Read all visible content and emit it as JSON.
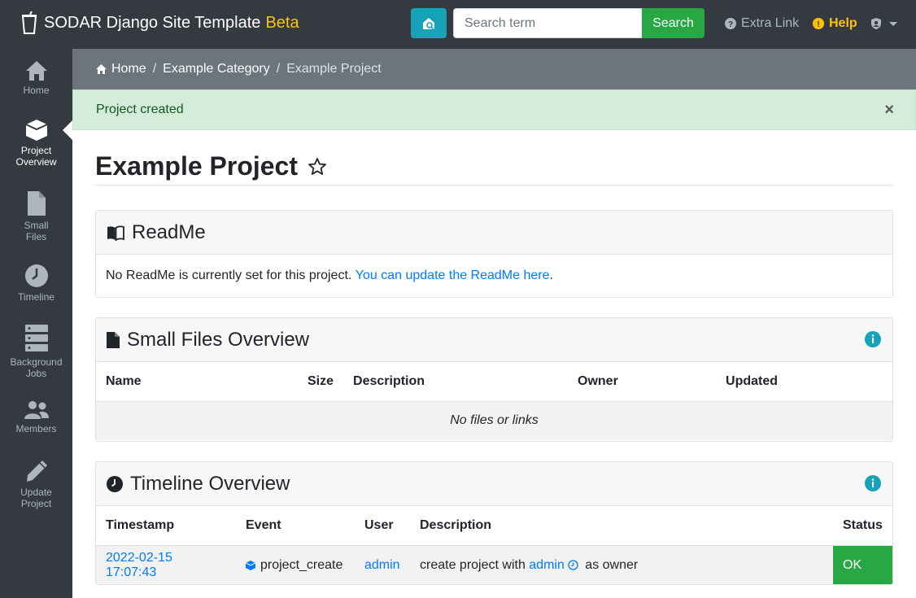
{
  "navbar": {
    "brand": "SODAR Django Site Template",
    "beta": "Beta",
    "search_placeholder": "Search term",
    "search_button": "Search",
    "extra_link": "Extra Link",
    "help": "Help"
  },
  "sidebar": {
    "items": [
      {
        "label": "Home",
        "icon": "home-icon"
      },
      {
        "label": "Project\nOverview",
        "icon": "cube-icon",
        "active": true
      },
      {
        "label": "Small\nFiles",
        "icon": "file-icon"
      },
      {
        "label": "Timeline",
        "icon": "clock-icon"
      },
      {
        "label": "Background\nJobs",
        "icon": "server-icon"
      },
      {
        "label": "Members",
        "icon": "users-icon"
      },
      {
        "label": "Update\nProject",
        "icon": "pencil-icon"
      }
    ]
  },
  "breadcrumb": {
    "home": "Home",
    "category": "Example Category",
    "current": "Example Project"
  },
  "alert": {
    "message": "Project created",
    "close": "×"
  },
  "page": {
    "title": "Example Project"
  },
  "readme": {
    "title": "ReadMe",
    "text": "No ReadMe is currently set for this project. ",
    "link": "You can update the ReadMe here",
    "suffix": "."
  },
  "small_files": {
    "title": "Small Files Overview",
    "columns": [
      "Name",
      "Size",
      "Description",
      "Owner",
      "Updated"
    ],
    "empty": "No files or links"
  },
  "timeline": {
    "title": "Timeline Overview",
    "columns": [
      "Timestamp",
      "Event",
      "User",
      "Description",
      "Status"
    ],
    "rows": [
      {
        "timestamp": "2022-02-15 17:07:43",
        "event": "project_create",
        "user": "admin",
        "desc_prefix": "create project with ",
        "desc_user": "admin",
        "desc_suffix": " as owner",
        "status": "OK"
      }
    ]
  },
  "colors": {
    "navbar": "#343a40",
    "accent_info": "#17a2b8",
    "success": "#28a745",
    "link": "#007bff",
    "beta": "#f5c518",
    "help": "#ffc107"
  }
}
